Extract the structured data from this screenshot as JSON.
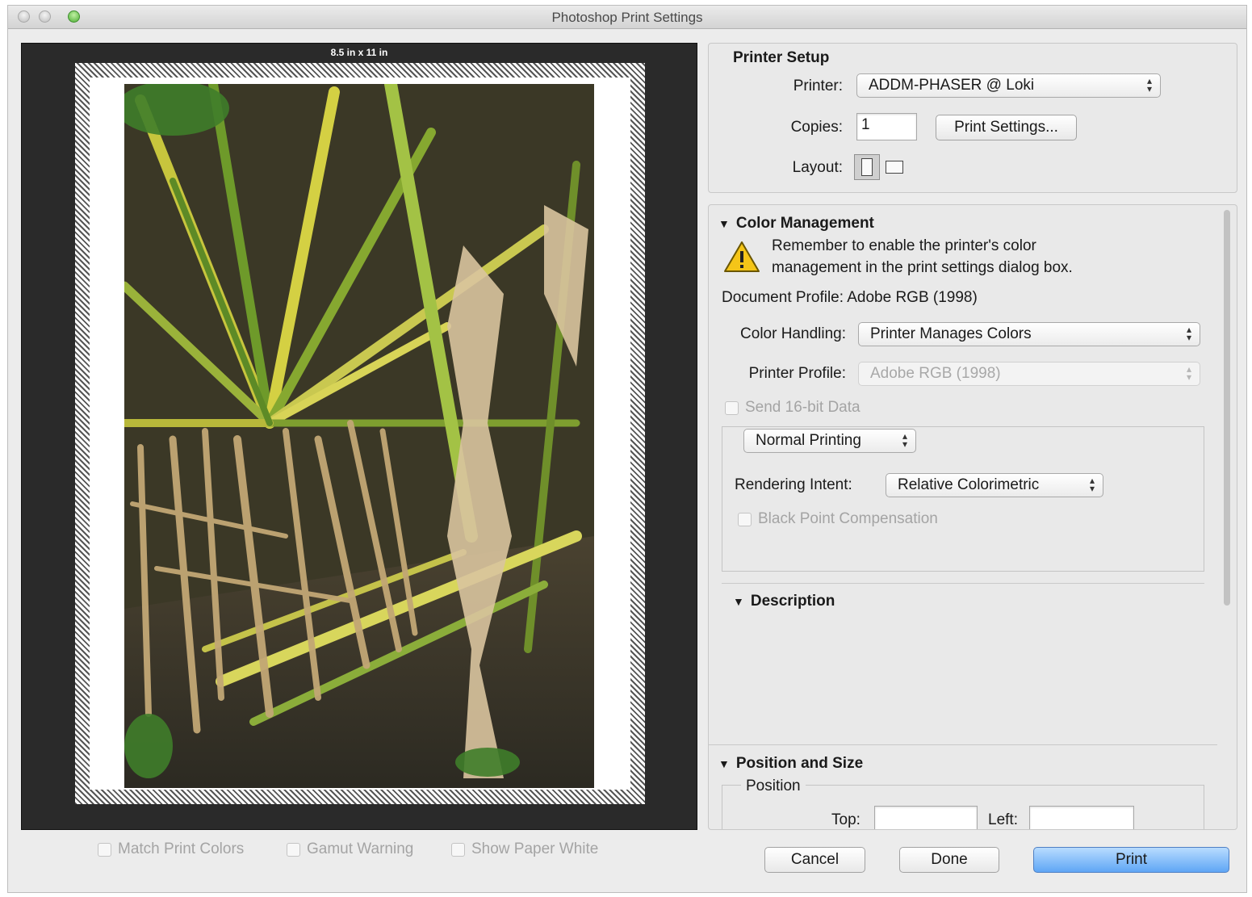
{
  "window": {
    "title": "Photoshop Print Settings"
  },
  "preview": {
    "paper_size": "8.5 in x 11 in",
    "options": {
      "match_print_colors": "Match Print Colors",
      "gamut_warning": "Gamut Warning",
      "show_paper_white": "Show Paper White"
    }
  },
  "printer_setup": {
    "heading": "Printer Setup",
    "printer_label": "Printer:",
    "printer_value": "ADDM-PHASER @ Loki",
    "copies_label": "Copies:",
    "copies_value": "1",
    "print_settings_button": "Print Settings...",
    "layout_label": "Layout:"
  },
  "color_management": {
    "heading": "Color Management",
    "warning_line1": "Remember to enable the printer's color",
    "warning_line2": "management in the print settings dialog box.",
    "document_profile": "Document Profile: Adobe RGB (1998)",
    "color_handling_label": "Color Handling:",
    "color_handling_value": "Printer Manages Colors",
    "printer_profile_label": "Printer Profile:",
    "printer_profile_value": "Adobe RGB (1998)",
    "send_16bit": "Send 16-bit Data",
    "printing_mode": "Normal Printing",
    "rendering_intent_label": "Rendering Intent:",
    "rendering_intent_value": "Relative Colorimetric",
    "black_point": "Black Point Compensation"
  },
  "description": {
    "heading": "Description"
  },
  "position_size": {
    "heading": "Position and Size",
    "position_label": "Position",
    "top_label": "Top:",
    "left_label": "Left:"
  },
  "buttons": {
    "cancel": "Cancel",
    "done": "Done",
    "print": "Print"
  }
}
